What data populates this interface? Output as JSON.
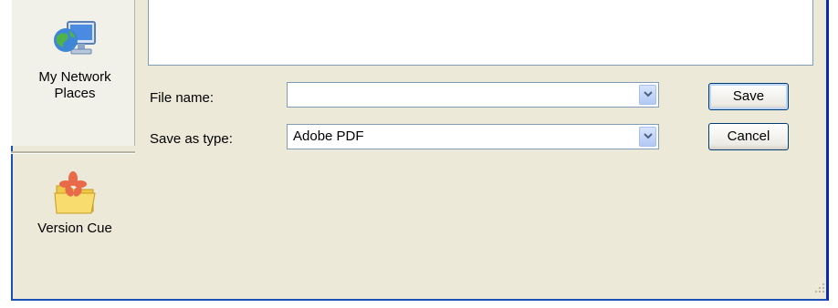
{
  "places": [
    {
      "label_line1": "My Network",
      "label_line2": "Places",
      "icon": "network-places-icon"
    },
    {
      "label_line1": "Version Cue",
      "icon": "version-cue-folder-icon"
    }
  ],
  "form": {
    "filename_label": "File name:",
    "filename_value": "",
    "type_label": "Save as type:",
    "type_value": "Adobe PDF"
  },
  "buttons": {
    "save": "Save",
    "cancel": "Cancel"
  },
  "colors": {
    "dialog_bg": "#ece9d8",
    "frame_blue": "#1a4fb8",
    "button_border": "#003c74"
  }
}
